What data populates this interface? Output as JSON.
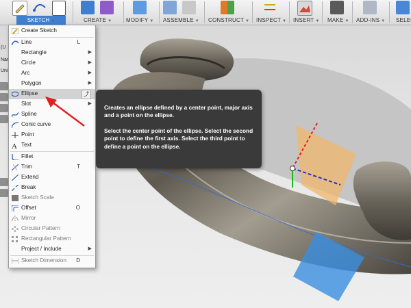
{
  "toolbar": {
    "sketch_label": "SKETCH",
    "groups": [
      {
        "label": "CREATE"
      },
      {
        "label": "MODIFY"
      },
      {
        "label": "ASSEMBLE"
      },
      {
        "label": "CONSTRUCT"
      },
      {
        "label": "INSPECT"
      },
      {
        "label": "INSERT"
      },
      {
        "label": "MAKE"
      },
      {
        "label": "ADD-INS"
      },
      {
        "label": "SELEC"
      }
    ]
  },
  "browser_strip": {
    "labels": [
      "(U",
      "Nar",
      "Uni"
    ]
  },
  "sketch_menu": {
    "items": [
      {
        "label": "Create Sketch",
        "shortcut": "",
        "icon": "create-sketch-icon"
      },
      {
        "label": "Line",
        "shortcut": "L",
        "icon": "line-icon"
      },
      {
        "label": "Rectangle",
        "icon": "none"
      },
      {
        "label": "Circle",
        "icon": "none"
      },
      {
        "label": "Arc",
        "icon": "none"
      },
      {
        "label": "Polygon",
        "icon": "none"
      },
      {
        "label": "Ellipse",
        "icon": "ellipse-icon",
        "pin": "pin-icon"
      },
      {
        "label": "Slot",
        "icon": "none"
      },
      {
        "label": "Spline",
        "icon": "spline-icon"
      },
      {
        "label": "Conic curve",
        "icon": "conic-curve-icon"
      },
      {
        "label": "Point",
        "icon": "point-icon"
      },
      {
        "label": "Text",
        "icon": "text-icon"
      },
      {
        "label": "Fillet",
        "icon": "fillet-icon"
      },
      {
        "label": "Trim",
        "shortcut": "T",
        "icon": "trim-icon"
      },
      {
        "label": "Extend",
        "icon": "extend-icon"
      },
      {
        "label": "Break",
        "icon": "break-icon"
      },
      {
        "label": "Sketch Scale",
        "icon": "sketch-scale-icon"
      },
      {
        "label": "Offset",
        "shortcut": "O",
        "icon": "offset-icon"
      },
      {
        "label": "Mirror",
        "icon": "mirror-icon"
      },
      {
        "label": "Circular Pattern",
        "icon": "circular-pattern-icon"
      },
      {
        "label": "Rectangular Pattern",
        "icon": "rectangular-pattern-icon"
      },
      {
        "label": "Project / Include",
        "icon": "none"
      },
      {
        "label": "Sketch Dimension",
        "shortcut": "D",
        "icon": "sketch-dimension-icon"
      }
    ]
  },
  "tooltip": {
    "paragraph1": "Creates an ellipse defined by a center point, major axis and a point on the ellipse.",
    "paragraph2": "Select the center point of the ellipse. Select the second point to define the first axis. Select the third point to define a point on the ellipse."
  },
  "colors": {
    "accent": "#3f7fd0",
    "annotation_arrow": "#e02020",
    "tooltip_bg": "#3a3a3a"
  }
}
